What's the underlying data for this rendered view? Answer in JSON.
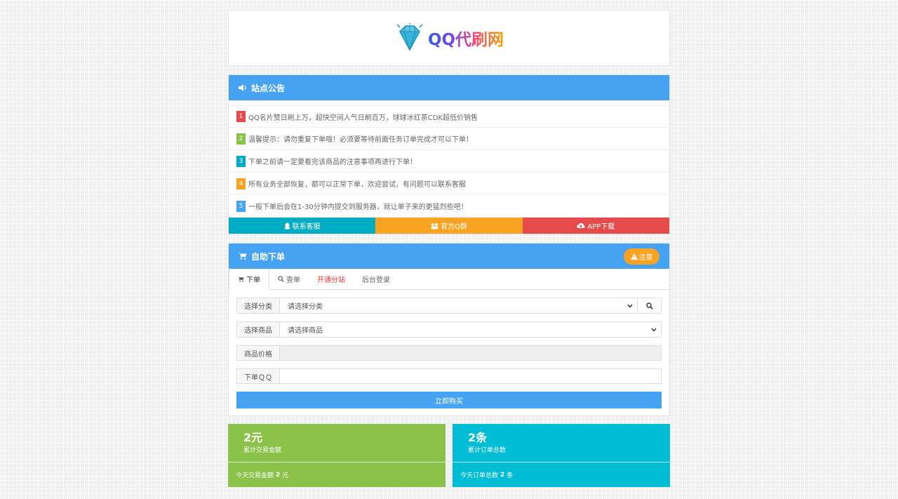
{
  "logo": {
    "text": "QQ代刷网"
  },
  "notice": {
    "title": "站点公告",
    "items": [
      {
        "num": "1",
        "text": "QQ名片赞日刷上万，超快空间人气日刷百万，球球冰红茶CDK超低价销售",
        "color": "#e64b4b"
      },
      {
        "num": "2",
        "text": "温馨提示：请勿重复下单哦！必须要等待前面任务订单完成才可以下单！",
        "color": "#8bc34a"
      },
      {
        "num": "3",
        "text": "下单之前请一定要看完该商品的注意事项再进行下单！",
        "color": "#00acc1"
      },
      {
        "num": "4",
        "text": "所有业务全部恢复，都可以正常下单，欢迎尝试，有问题可以联系客服",
        "color": "#f8a322"
      },
      {
        "num": "5",
        "text": "一般下单后会在1-30分钟内提交到服务器，就让单子来的更猛烈些吧！",
        "color": "#45a3f2"
      }
    ],
    "buttons": [
      {
        "label": "联系客服",
        "color": "#00acc1"
      },
      {
        "label": "官方Q群",
        "color": "#f8a322"
      },
      {
        "label": "APP下载",
        "color": "#e64b4b"
      }
    ]
  },
  "order": {
    "title": "自助下单",
    "note_label": "注意",
    "tabs": [
      "下单",
      "查单",
      "开通分站",
      "后台登录"
    ],
    "form": {
      "category_label": "选择分类",
      "category_value": "请选择分类",
      "product_label": "选择商品",
      "product_value": "请选择商品",
      "price_label": "商品价格",
      "price_value": "",
      "qq_label": "下单ＱＱ",
      "qq_value": "",
      "buy_label": "立即购买"
    }
  },
  "stats": [
    {
      "big": "2元",
      "sub": "累计交易金额",
      "bottom_prefix": "今天交易金额",
      "bottom_value": "2",
      "bottom_unit": "元",
      "color": "#8bc34a"
    },
    {
      "big": "2条",
      "sub": "累计订单总数",
      "bottom_prefix": "今天订单总数",
      "bottom_value": "2",
      "bottom_unit": "条",
      "color": "#00bcd4"
    }
  ]
}
